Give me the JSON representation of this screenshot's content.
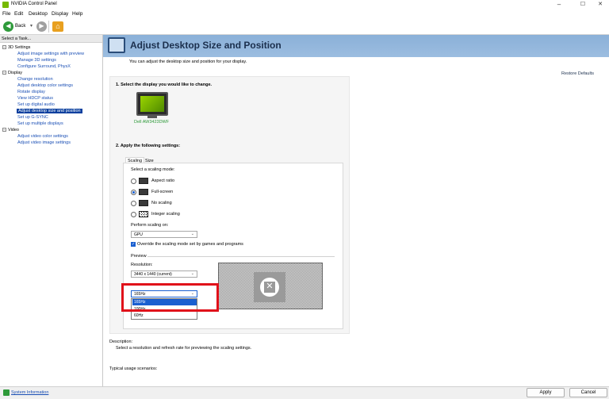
{
  "window": {
    "title": "NVIDIA Control Panel",
    "minimize": "–",
    "maximize": "☐",
    "close": "✕"
  },
  "menu": {
    "file": "File",
    "edit": "Edit",
    "desktop": "Desktop",
    "display": "Display",
    "help": "Help"
  },
  "toolbar": {
    "back": "Back"
  },
  "task_panel": {
    "header": "Select a Task...",
    "categories": [
      {
        "label": "3D Settings",
        "items": [
          "Adjust image settings with preview",
          "Manage 3D settings",
          "Configure Surround, PhysX"
        ]
      },
      {
        "label": "Display",
        "items": [
          "Change resolution",
          "Adjust desktop color settings",
          "Rotate display",
          "View HDCP status",
          "Set up digital audio",
          "Adjust desktop size and position",
          "Set up G-SYNC",
          "Set up multiple displays"
        ]
      },
      {
        "label": "Video",
        "items": [
          "Adjust video color settings",
          "Adjust video image settings"
        ]
      }
    ]
  },
  "page": {
    "title": "Adjust Desktop Size and Position",
    "subtitle": "You can adjust the desktop size and position for your display.",
    "restore": "Restore Defaults",
    "step1": "1. Select the display you would like to change.",
    "display_name": "Dell AW3423DWF",
    "step2": "2. Apply the following settings:",
    "tabs": [
      "Scaling",
      "Size"
    ],
    "scaling_mode_label": "Select a scaling mode:",
    "modes": [
      "Aspect ratio",
      "Full-screen",
      "No scaling",
      "Integer scaling"
    ],
    "perform_on_label": "Perform scaling on:",
    "perform_on_value": "GPU",
    "override_label": "Override the scaling mode set by games and programs",
    "preview_label": "Preview",
    "resolution_label": "Resolution:",
    "resolution_value": "3440 x 1440 (current)",
    "refresh_value": "165Hz",
    "refresh_options": [
      "165Hz",
      "100Hz",
      "60Hz"
    ],
    "description_label": "Description:",
    "description_text": "Select a resolution and refresh rate for previewing the scaling settings.",
    "usage_label": "Typical usage scenarios:"
  },
  "status": {
    "system_info": "System Information",
    "apply": "Apply",
    "cancel": "Cancel"
  },
  "colors": {
    "nvidia_green": "#76b900",
    "highlight_red": "#e0101a",
    "selection_blue": "#0a3f9e"
  }
}
